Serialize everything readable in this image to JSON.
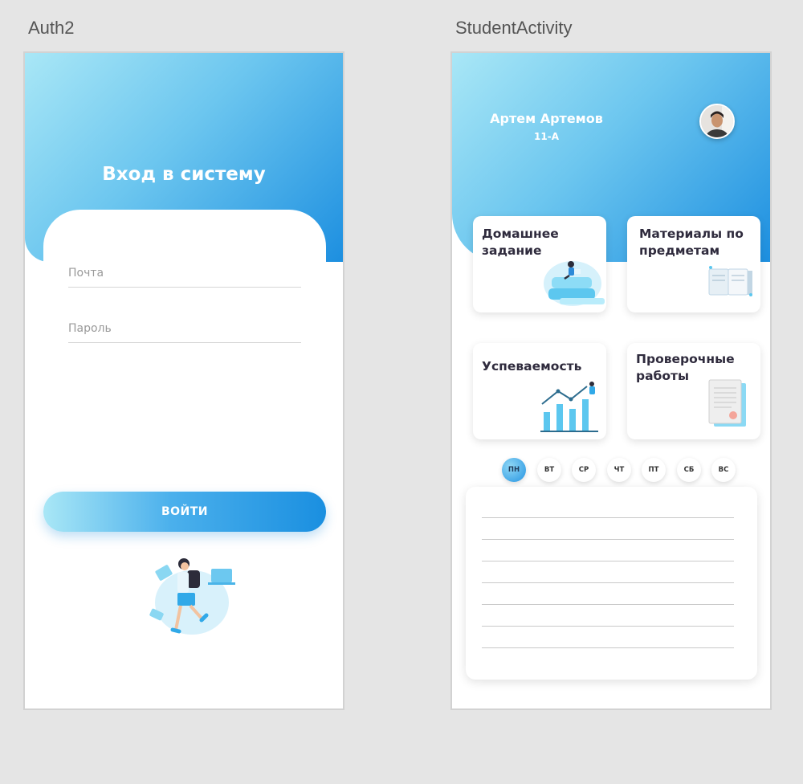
{
  "frames": {
    "auth": {
      "label": "Auth2",
      "title": "Вход в систему",
      "email_placeholder": "Почта",
      "password_placeholder": "Пароль",
      "login_label": "ВОЙТИ"
    },
    "student": {
      "label": "StudentActivity",
      "user_name": "Артем Артемов",
      "user_class": "11-А",
      "tiles": [
        {
          "title": "Домашнее задание"
        },
        {
          "title": "Материалы по предметам"
        },
        {
          "title": "Успеваемость"
        },
        {
          "title": "Проверочные работы"
        }
      ],
      "days": [
        "ПН",
        "ВТ",
        "СР",
        "ЧТ",
        "ПТ",
        "СБ",
        "ВС"
      ],
      "active_day_index": 0,
      "schedule_rows": 7
    }
  },
  "colors": {
    "gradient_light": "#a9e7f6",
    "gradient_dark": "#1d8fe0",
    "title_text": "#2f2b3d",
    "canvas_bg": "#e5e5e5"
  },
  "icons": [
    "runner-illustration",
    "homework-illustration",
    "books-illustration",
    "chart-illustration",
    "documents-illustration",
    "avatar-photo"
  ]
}
